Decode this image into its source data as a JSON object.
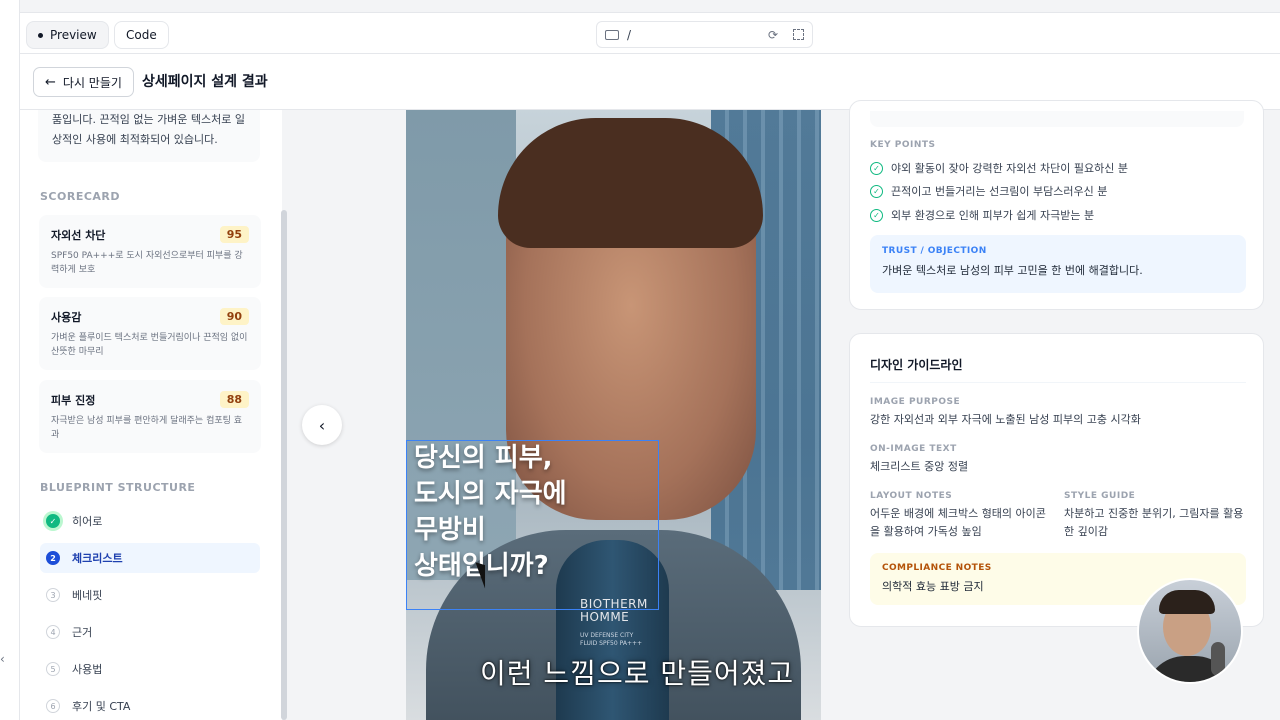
{
  "topbar": {
    "tabs": [
      "Preview",
      "Code"
    ],
    "url_path": "/"
  },
  "header": {
    "back_label": "다시 만들기",
    "title": "상세페이지 설계 결과"
  },
  "sidebar": {
    "description": "품입니다. 끈적임 없는 가벼운 텍스처로 일상적인 사용에 최적화되어 있습니다.",
    "scorecard_label": "SCORECARD",
    "scores": [
      {
        "title": "자외선 차단",
        "score": "95",
        "desc": "SPF50 PA+++로 도시 자외선으로부터 피부를 강력하게 보호"
      },
      {
        "title": "사용감",
        "score": "90",
        "desc": "가벼운 플루이드 텍스처로 번들거림이나 끈적임 없이 산뜻한 마무리"
      },
      {
        "title": "피부 진정",
        "score": "88",
        "desc": "자극받은 남성 피부를 편안하게 달래주는 컴포팅 효과"
      }
    ],
    "blueprint_label": "BLUEPRINT STRUCTURE",
    "steps": [
      {
        "num": "",
        "label": "히어로"
      },
      {
        "num": "2",
        "label": "체크리스트"
      },
      {
        "num": "3",
        "label": "베네핏"
      },
      {
        "num": "4",
        "label": "근거"
      },
      {
        "num": "5",
        "label": "사용법"
      },
      {
        "num": "6",
        "label": "후기 및 CTA"
      }
    ]
  },
  "preview": {
    "overlay_lines": [
      "당신의 피부,",
      "도시의 자극에",
      "무방비",
      "상태입니까?"
    ],
    "bottle_brand": [
      "BIOTHERM",
      "HOMME"
    ],
    "bottle_sub": [
      "UV DEFENSE CITY",
      "FLUID SPF50 PA+++"
    ],
    "video_subtitle": "이런 느낌으로 만들어졌고"
  },
  "key_points": {
    "label": "KEY POINTS",
    "items": [
      "야외 활동이 잦아 강력한 자외선 차단이 필요하신 분",
      "끈적이고 번들거리는 선크림이 부담스러우신 분",
      "외부 환경으로 인해 피부가 쉽게 자극받는 분"
    ],
    "trust_label": "TRUST / OBJECTION",
    "trust_text": "가벼운 텍스처로 남성의 피부 고민을 한 번에 해결합니다."
  },
  "design_guide": {
    "title": "디자인 가이드라인",
    "image_purpose_label": "IMAGE PURPOSE",
    "image_purpose": "강한 자외선과 외부 자극에 노출된 남성 피부의 고충 시각화",
    "on_image_text_label": "ON-IMAGE TEXT",
    "on_image_text": "체크리스트 중앙 정렬",
    "layout_notes_label": "LAYOUT NOTES",
    "layout_notes": "어두운 배경에 체크박스 형태의 아이콘을 활용하여 가독성 높임",
    "style_guide_label": "STYLE GUIDE",
    "style_guide": "차분하고 진중한 분위기, 그림자를 활용한 깊이감",
    "compliance_label": "COMPLIANCE NOTES",
    "compliance_text": "의학적 효능 표방 금지"
  }
}
